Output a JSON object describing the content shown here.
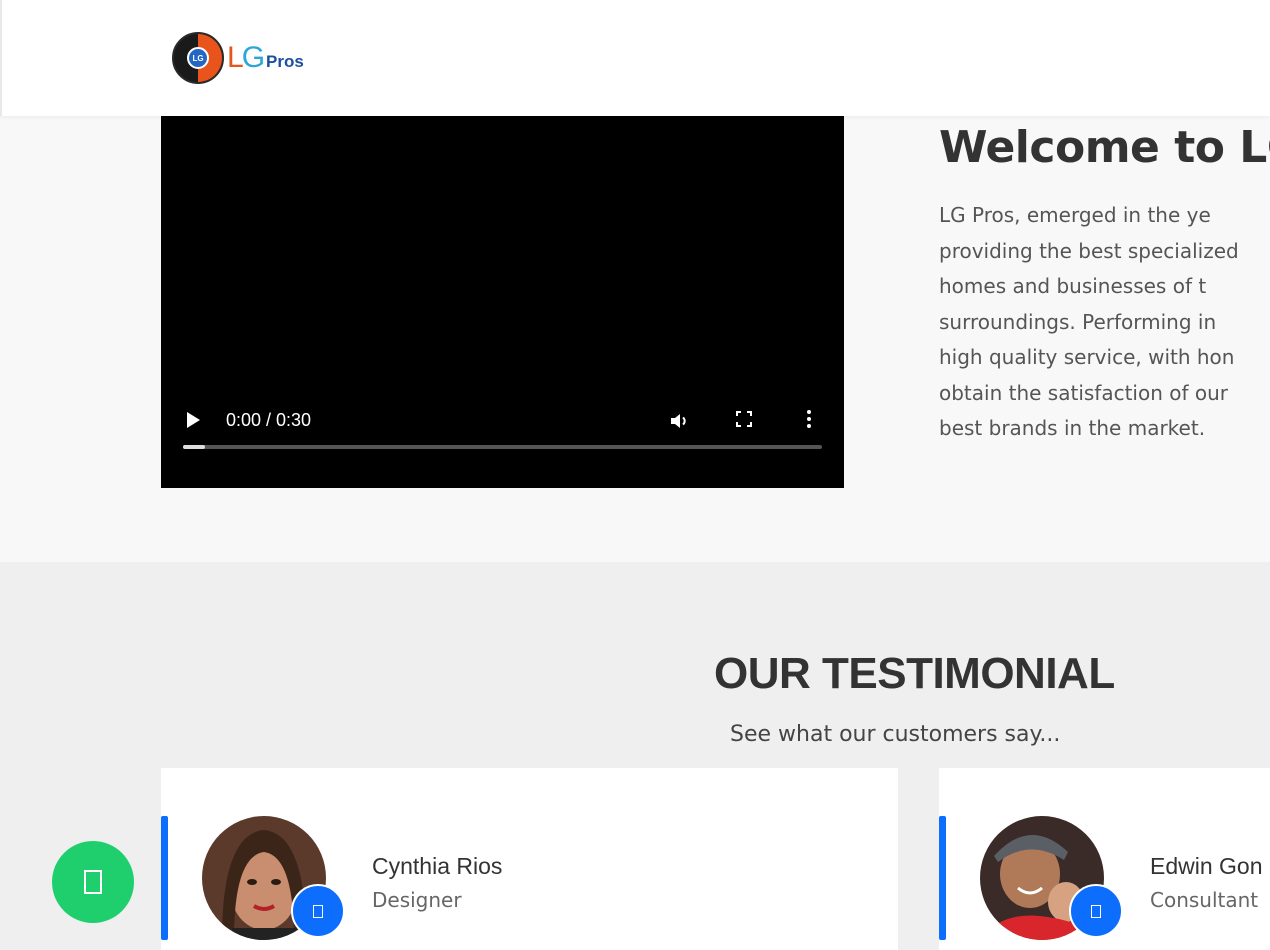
{
  "header": {
    "logo": {
      "badge_text": "LG",
      "text_l": "L",
      "text_g": "G",
      "text_pros": "Pros",
      "colors": {
        "orange": "#e8541c",
        "blue": "#2466c4",
        "navy": "#1c4fa0"
      }
    }
  },
  "video": {
    "time": "0:00 / 0:30",
    "progress": 0.035,
    "icons": [
      "play-icon",
      "volume-icon",
      "fullscreen-icon",
      "more-options-icon"
    ]
  },
  "welcome": {
    "title": "Welcome to LG",
    "lines": [
      "LG Pros, emerged in the ye",
      "providing the best specialized",
      "homes and businesses of t",
      "surroundings. Performing in",
      "high quality service, with hon",
      "obtain the satisfaction of our",
      "best brands in the market."
    ]
  },
  "testimonials": {
    "title": "OUR TESTIMONIAL",
    "subtitle": "See what our customers say...",
    "accent": "#0d6efd",
    "items": [
      {
        "name": "Cynthia Rios",
        "role": "Designer"
      },
      {
        "name": "Edwin Gon",
        "role": "Consultant"
      }
    ]
  },
  "chat": {
    "color": "#1fcf6e",
    "icon": "whatsapp-icon"
  }
}
